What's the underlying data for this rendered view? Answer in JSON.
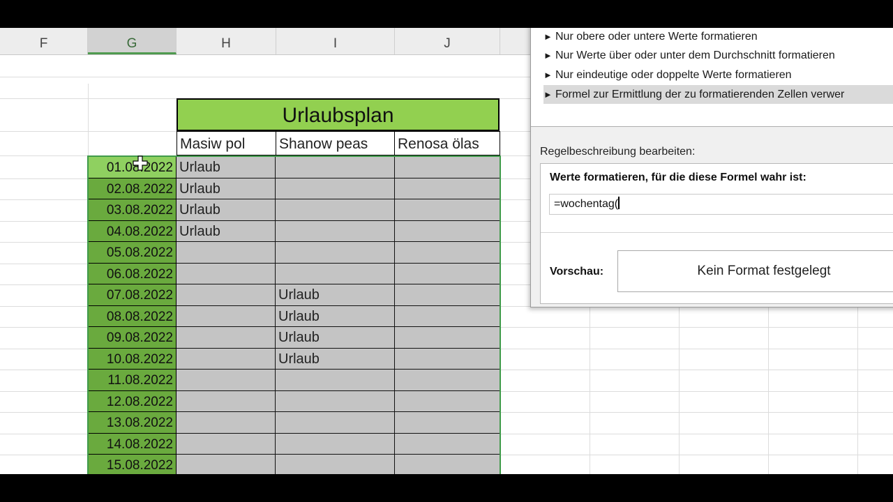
{
  "columns": [
    "F",
    "G",
    "H",
    "I",
    "J"
  ],
  "table": {
    "title": "Urlaubsplan",
    "headers": [
      "Masiw pol",
      "Shanow peas",
      "Renosa ölas"
    ],
    "rows": [
      {
        "date": "01.08.2022",
        "cells": [
          "Urlaub",
          "",
          ""
        ]
      },
      {
        "date": "02.08.2022",
        "cells": [
          "Urlaub",
          "",
          ""
        ]
      },
      {
        "date": "03.08.2022",
        "cells": [
          "Urlaub",
          "",
          ""
        ]
      },
      {
        "date": "04.08.2022",
        "cells": [
          "Urlaub",
          "",
          ""
        ]
      },
      {
        "date": "05.08.2022",
        "cells": [
          "",
          "",
          ""
        ]
      },
      {
        "date": "06.08.2022",
        "cells": [
          "",
          "",
          ""
        ]
      },
      {
        "date": "07.08.2022",
        "cells": [
          "",
          "Urlaub",
          ""
        ]
      },
      {
        "date": "08.08.2022",
        "cells": [
          "",
          "Urlaub",
          ""
        ]
      },
      {
        "date": "09.08.2022",
        "cells": [
          "",
          "Urlaub",
          ""
        ]
      },
      {
        "date": "10.08.2022",
        "cells": [
          "",
          "Urlaub",
          ""
        ]
      },
      {
        "date": "11.08.2022",
        "cells": [
          "",
          "",
          ""
        ]
      },
      {
        "date": "12.08.2022",
        "cells": [
          "",
          "",
          ""
        ]
      },
      {
        "date": "13.08.2022",
        "cells": [
          "",
          "",
          ""
        ]
      },
      {
        "date": "14.08.2022",
        "cells": [
          "",
          "",
          ""
        ]
      },
      {
        "date": "15.08.2022",
        "cells": [
          "",
          "",
          ""
        ]
      }
    ]
  },
  "dialog": {
    "rule_types": [
      "Nur obere oder untere Werte formatieren",
      "Nur Werte über oder unter dem Durchschnitt formatieren",
      "Nur eindeutige oder doppelte Werte formatieren",
      "Formel zur Ermittlung der zu formatierenden Zellen verwer"
    ],
    "selected_rule_index": 3,
    "description_label": "Regelbeschreibung bearbeiten:",
    "formula_label": "Werte formatieren, für die diese Formel wahr ist:",
    "formula_value": "=wochentag(",
    "preview_label": "Vorschau:",
    "preview_text": "Kein Format festgelegt"
  },
  "colors": {
    "title_fill": "#92d050",
    "date_fill": "#6aaa3e",
    "cell_fill": "#c4c4c4",
    "selection_border": "#3f9a4a"
  }
}
